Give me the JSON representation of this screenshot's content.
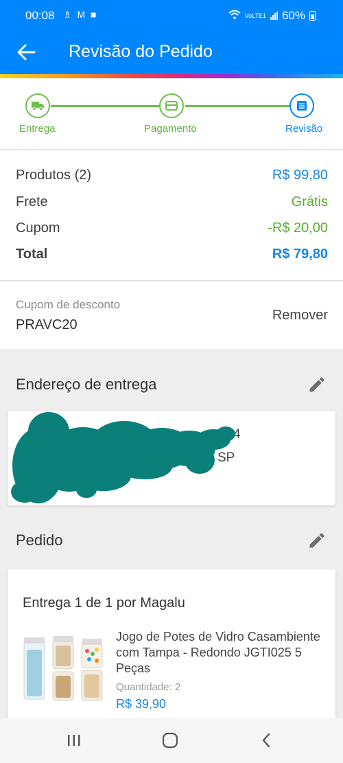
{
  "status_bar": {
    "time": "00:08",
    "notification_icons": [
      "accessibility-icon",
      "gmail-icon",
      "app-icon"
    ],
    "network_label": "VoLTE1",
    "battery": "60%"
  },
  "app_bar": {
    "title": "Revisão do Pedido"
  },
  "stepper": {
    "steps": [
      {
        "label": "Entrega",
        "icon": "truck-icon",
        "state": "done"
      },
      {
        "label": "Pagamento",
        "icon": "card-icon",
        "state": "done"
      },
      {
        "label": "Revisão",
        "icon": "list-icon",
        "state": "current"
      }
    ]
  },
  "summary": {
    "products_label": "Produtos (2)",
    "products_value": "R$ 99,80",
    "shipping_label": "Frete",
    "shipping_value": "Grátis",
    "coupon_label": "Cupom",
    "coupon_value": "-R$ 20,00",
    "total_label": "Total",
    "total_value": "R$ 79,80"
  },
  "coupon": {
    "label": "Cupom de desconto",
    "code": "PRAVC20",
    "remove_label": "Remover"
  },
  "address_section": {
    "title": "Endereço de entrega",
    "visible_fragments": [
      "4",
      "SP"
    ]
  },
  "order_section": {
    "title": "Pedido",
    "delivery_label": "Entrega 1 de 1 por Magalu",
    "product": {
      "name": "Jogo de Potes de Vidro Casambiente com Tampa - Redondo JGTI025 5 Peças",
      "quantity_label": "Quantidade:",
      "quantity": "2",
      "price": "R$ 39,90"
    }
  },
  "colors": {
    "primary": "#0086ff",
    "success": "#6cc04a",
    "price_blue": "#1a86e0",
    "redaction": "#0b7f7a"
  }
}
